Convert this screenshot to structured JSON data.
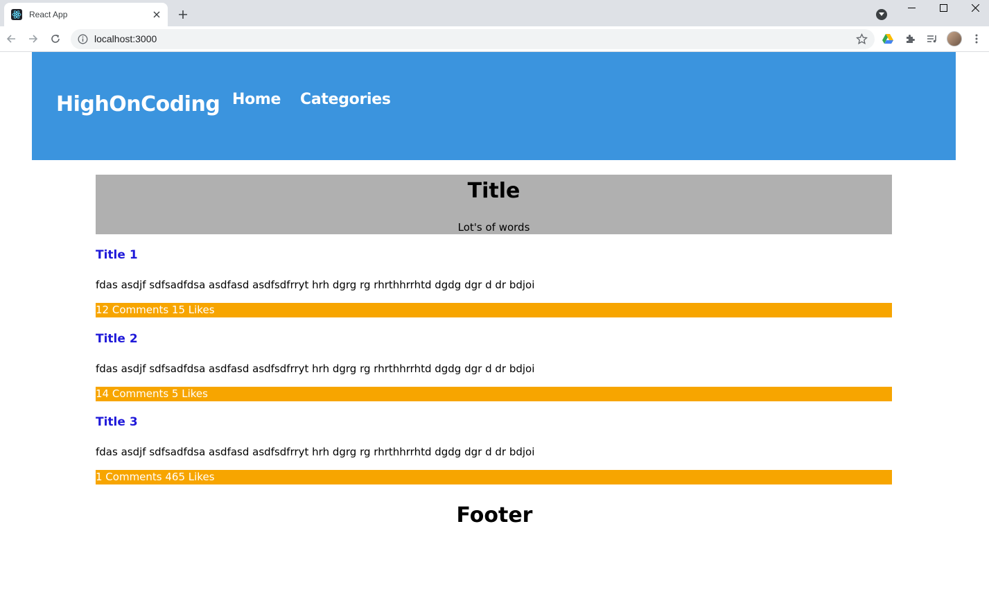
{
  "browser": {
    "tab_title": "React App",
    "url": "localhost:3000",
    "icons": [
      "react-favicon",
      "close-icon",
      "plus-icon",
      "tab-search-icon",
      "minimize-icon",
      "maximize-icon",
      "window-close-icon",
      "back-icon",
      "forward-icon",
      "reload-icon",
      "info-icon",
      "star-icon",
      "google-drive-icon",
      "extensions-icon",
      "reading-list-icon",
      "avatar",
      "kebab-menu-icon"
    ]
  },
  "navbar": {
    "brand": "HighOnCoding",
    "links": [
      "Home",
      "Categories"
    ],
    "background": "#3b94de"
  },
  "hero": {
    "title": "Title",
    "subtitle": "Lot's of words",
    "background": "#b0b0b0"
  },
  "posts": [
    {
      "title": "Title 1",
      "body": "fdas asdjf sdfsadfdsa asdfasd asdfsdfrryt hrh dgrg rg rhrthhrrhtd dgdg dgr d dr bdjoi",
      "meta": "12 Comments 15 Likes"
    },
    {
      "title": "Title 2",
      "body": "fdas asdjf sdfsadfdsa asdfasd asdfsdfrryt hrh dgrg rg rhrthhrrhtd dgdg dgr d dr bdjoi",
      "meta": "14 Comments 5 Likes"
    },
    {
      "title": "Title 3",
      "body": "fdas asdjf sdfsadfdsa asdfasd asdfsdfrryt hrh dgrg rg rhrthhrrhtd dgdg dgr d dr bdjoi",
      "meta": "1 Comments 465 Likes"
    }
  ],
  "colors": {
    "post_title": "#1f19d9",
    "meta_bar": "#f7a500"
  },
  "footer": {
    "text": "Footer"
  }
}
